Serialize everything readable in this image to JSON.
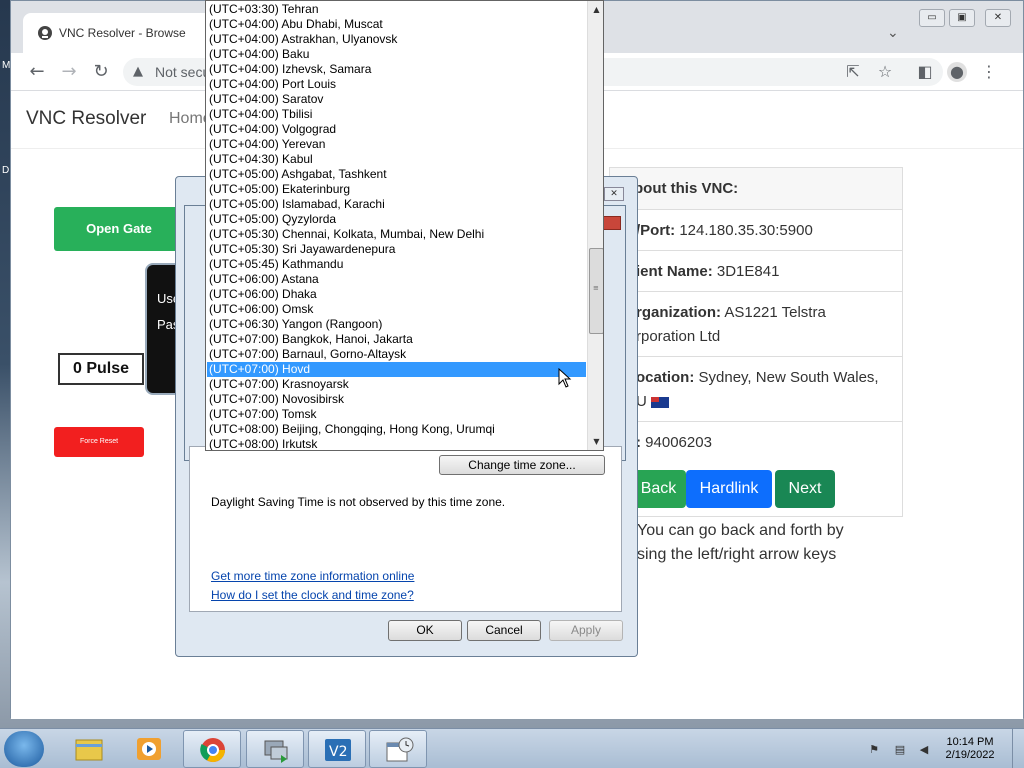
{
  "browser": {
    "tab_title": "VNC Resolver - Browse",
    "omnibox_text": "Not secu",
    "address_warning_icon": "warning-triangle-icon"
  },
  "desktop": {
    "letter_m": "M",
    "letter_d": "D"
  },
  "page": {
    "brand": "VNC Resolver",
    "nav_home": "Home",
    "open_gate": "Open Gate",
    "black_card_line1": "Use",
    "black_card_line2": "Pas",
    "pulse": "0 Pulse",
    "force_reset": "Force Reset",
    "info": {
      "heading": "bout this VNC:",
      "ip_label": "/Port:",
      "ip_value": "124.180.35.30:5900",
      "client_label": "ient Name:",
      "client_value": "3D1E841",
      "org_label": "rganization:",
      "org_value": "AS1221 Telstra",
      "org_value2": "rporation Ltd",
      "loc_label": "ocation:",
      "loc_value": "Sydney, New South Wales,",
      "loc_value2": "U",
      "id_label": ":",
      "id_value": "94006203"
    },
    "back": "Back",
    "hardlink": "Hardlink",
    "next": "Next",
    "hint_line1": "You can go back and forth by",
    "hint_line2": "sing the left/right arrow keys"
  },
  "dialog": {
    "change_tz": "Change time zone...",
    "dst_text": "Daylight Saving Time is not observed by this time zone.",
    "link_more": "Get more time zone information online",
    "link_how": "How do I set the clock and time zone?",
    "ok": "OK",
    "cancel": "Cancel",
    "apply": "Apply"
  },
  "timezones": [
    "(UTC+03:30) Tehran",
    "(UTC+04:00) Abu Dhabi, Muscat",
    "(UTC+04:00) Astrakhan, Ulyanovsk",
    "(UTC+04:00) Baku",
    "(UTC+04:00) Izhevsk, Samara",
    "(UTC+04:00) Port Louis",
    "(UTC+04:00) Saratov",
    "(UTC+04:00) Tbilisi",
    "(UTC+04:00) Volgograd",
    "(UTC+04:00) Yerevan",
    "(UTC+04:30) Kabul",
    "(UTC+05:00) Ashgabat, Tashkent",
    "(UTC+05:00) Ekaterinburg",
    "(UTC+05:00) Islamabad, Karachi",
    "(UTC+05:00) Qyzylorda",
    "(UTC+05:30) Chennai, Kolkata, Mumbai, New Delhi",
    "(UTC+05:30) Sri Jayawardenepura",
    "(UTC+05:45) Kathmandu",
    "(UTC+06:00) Astana",
    "(UTC+06:00) Dhaka",
    "(UTC+06:00) Omsk",
    "(UTC+06:30) Yangon (Rangoon)",
    "(UTC+07:00) Bangkok, Hanoi, Jakarta",
    "(UTC+07:00) Barnaul, Gorno-Altaysk",
    "(UTC+07:00) Hovd",
    "(UTC+07:00) Krasnoyarsk",
    "(UTC+07:00) Novosibirsk",
    "(UTC+07:00) Tomsk",
    "(UTC+08:00) Beijing, Chongqing, Hong Kong, Urumqi",
    "(UTC+08:00) Irkutsk"
  ],
  "selected_timezone": "(UTC+07:00) Hovd",
  "taskbar": {
    "time": "10:14 PM",
    "date": "2/19/2022",
    "apps": [
      "explorer-icon",
      "media-player-icon",
      "chrome-icon",
      "network-transfer-icon",
      "vnc-viewer-icon",
      "date-time-icon"
    ]
  },
  "colors": {
    "open_gate": "#28b05a",
    "force_reset": "#f21f1f",
    "hardlink": "#0d6efd",
    "next": "#198754",
    "selection": "#3399ff"
  }
}
